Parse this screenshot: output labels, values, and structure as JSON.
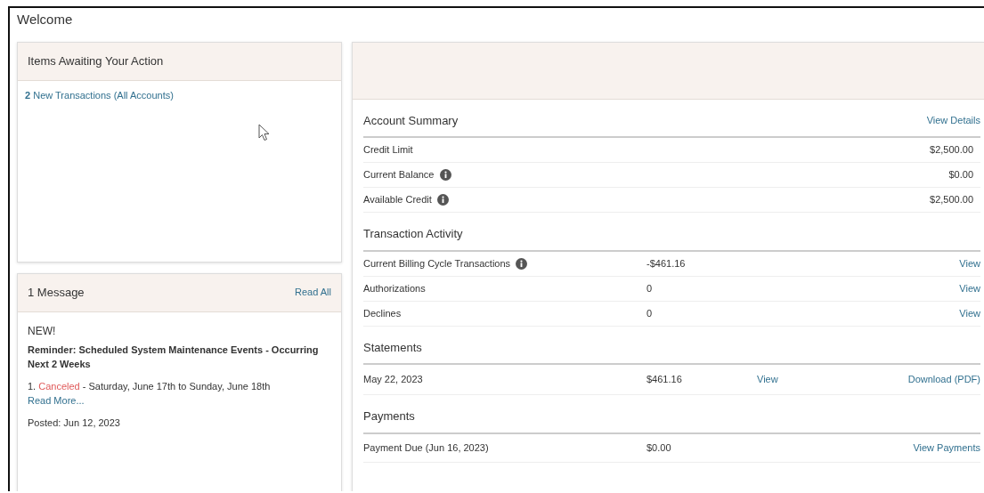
{
  "page": {
    "title": "Welcome"
  },
  "action_panel": {
    "title": "Items Awaiting Your Action",
    "items": [
      {
        "count": "2",
        "label": "New Transactions (All Accounts)"
      }
    ]
  },
  "messages_panel": {
    "title": "1 Message",
    "read_all": "Read All",
    "message": {
      "badge": "NEW!",
      "subject": "Reminder: Scheduled System Maintenance Events - Occurring Next 2 Weeks",
      "line_number": "1.",
      "line_status": "Canceled",
      "line_text": "- Saturday, June 17th to Sunday, June 18th",
      "read_more": "Read More...",
      "posted": "Posted: Jun 12, 2023"
    }
  },
  "account_summary": {
    "title": "Account Summary",
    "link": "View Details",
    "rows": [
      {
        "label": "Credit Limit",
        "info": false,
        "value": "$2,500.00"
      },
      {
        "label": "Current Balance",
        "info": true,
        "value": "$0.00"
      },
      {
        "label": "Available Credit",
        "info": true,
        "value": "$2,500.00"
      }
    ]
  },
  "transaction_activity": {
    "title": "Transaction Activity",
    "rows": [
      {
        "label": "Current Billing Cycle Transactions",
        "info": true,
        "amount": "-$461.16",
        "link": "View"
      },
      {
        "label": "Authorizations",
        "info": false,
        "amount": "0",
        "link": "View"
      },
      {
        "label": "Declines",
        "info": false,
        "amount": "0",
        "link": "View"
      }
    ]
  },
  "statements": {
    "title": "Statements",
    "rows": [
      {
        "date": "May 22, 2023",
        "amount": "$461.16",
        "view": "View",
        "download": "Download (PDF)"
      }
    ]
  },
  "payments": {
    "title": "Payments",
    "rows": [
      {
        "label": "Payment Due (Jun 16, 2023)",
        "amount": "$0.00",
        "link": "View Payments"
      }
    ]
  }
}
